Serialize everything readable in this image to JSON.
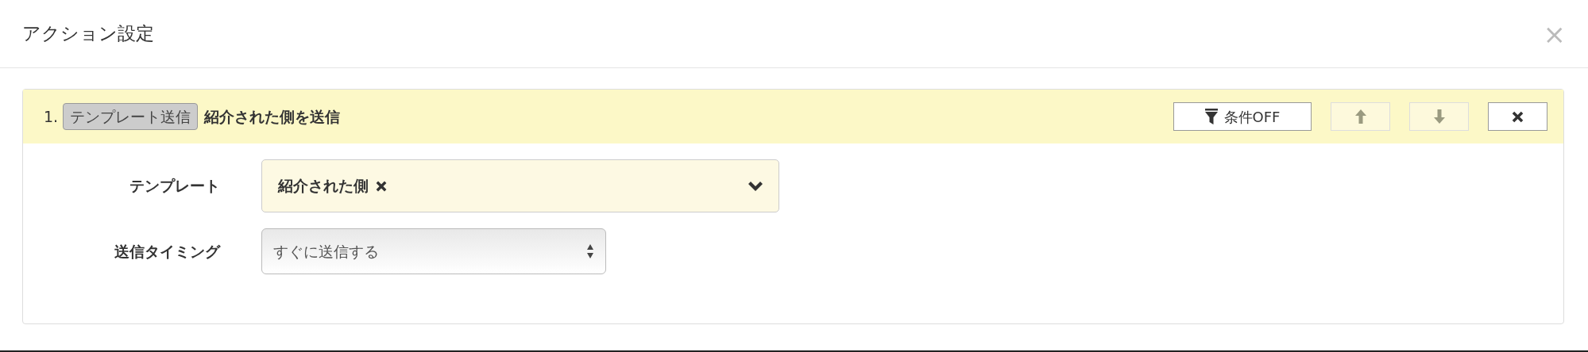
{
  "modal": {
    "title": "アクション設定",
    "close": "×"
  },
  "action": {
    "number": "1.",
    "type_badge": "テンプレート送信",
    "name": "紹介された側を送信",
    "controls": [
      {
        "kind": "condition",
        "label": "条件OFF",
        "disabled": false
      },
      {
        "kind": "up",
        "disabled": true
      },
      {
        "kind": "down",
        "disabled": true
      },
      {
        "kind": "delete",
        "disabled": false
      }
    ],
    "fields": [
      {
        "kind": "tag-select",
        "label": "テンプレート",
        "tags": [
          "紹介された側"
        ]
      },
      {
        "kind": "select",
        "label": "送信タイミング",
        "value": "すぐに送信する"
      }
    ]
  }
}
